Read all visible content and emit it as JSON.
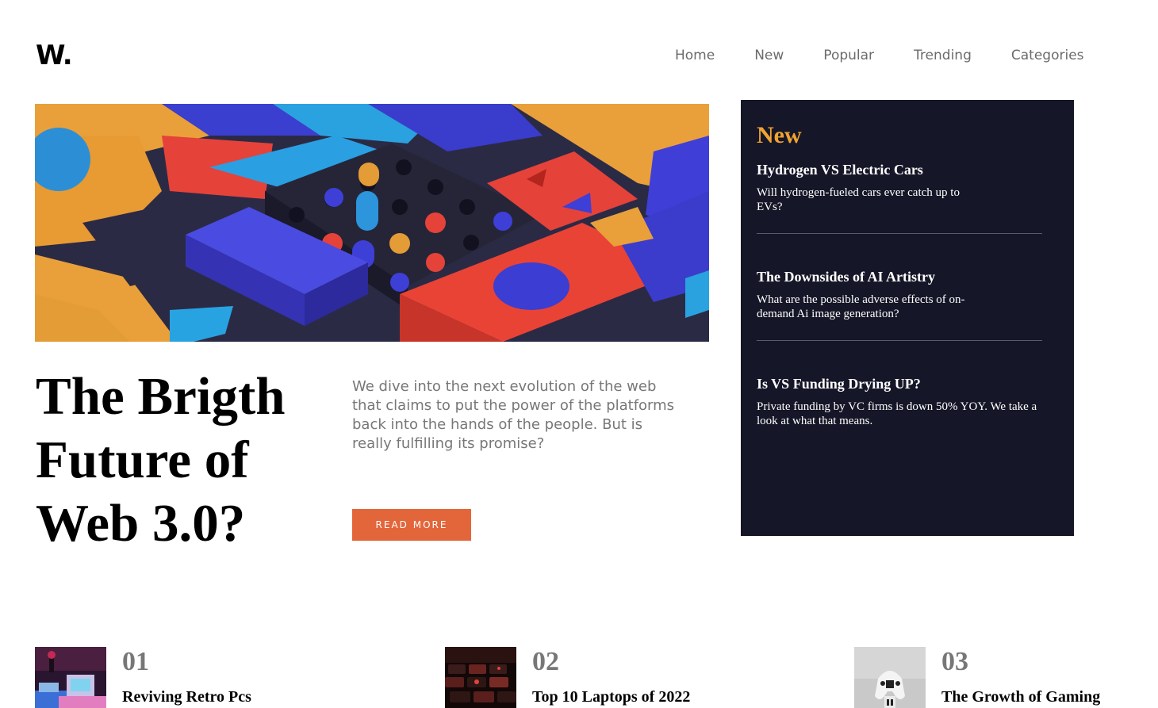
{
  "brand": {
    "logo": "W."
  },
  "nav": {
    "items": [
      "Home",
      "New",
      "Popular",
      "Trending",
      "Categories"
    ]
  },
  "hero": {
    "title": "The Brigth Future of Web 3.0?",
    "description": "We dive into the next evolution of the web that claims to put the power of the platforms back into the hands of the people. But is really fulfilling its promise?",
    "cta": "READ MORE"
  },
  "new_panel": {
    "heading": "New",
    "items": [
      {
        "title": "Hydrogen VS Electric Cars",
        "desc": "Will hydrogen-fueled cars ever catch up to EVs?"
      },
      {
        "title": "The Downsides of AI Artistry",
        "desc": "What are the possible adverse effects of on-demand Ai image generation?"
      },
      {
        "title": "Is VS Funding Drying UP?",
        "desc": "Private funding by VC firms is down 50% YOY. We take a look at what that means."
      }
    ]
  },
  "cards": [
    {
      "number": "01",
      "title": "Reviving Retro Pcs"
    },
    {
      "number": "02",
      "title": "Top 10 Laptops of 2022"
    },
    {
      "number": "03",
      "title": "The Growth of Gaming"
    }
  ],
  "colors": {
    "accent": "#e3653a",
    "panel_bg": "#151627",
    "panel_heading": "#f0a232"
  }
}
